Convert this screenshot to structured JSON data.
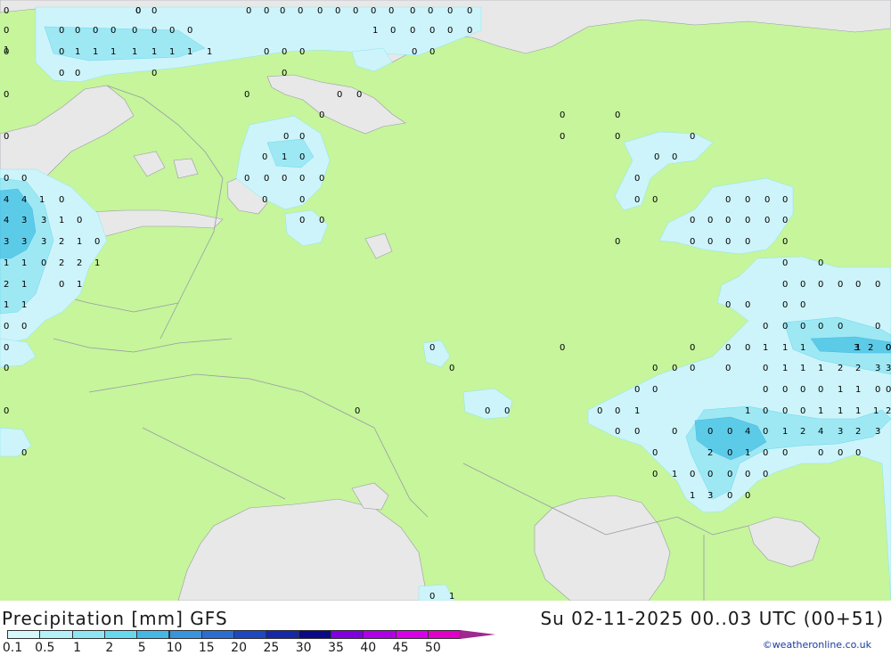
{
  "header": {
    "title": "Precipitation [mm] GFS",
    "datetime": "Su 02-11-2025 00..03 UTC (00+51)"
  },
  "credit": "©weatheronline.co.uk",
  "legend": {
    "ticks": [
      "0.1",
      "0.5",
      "1",
      "2",
      "5",
      "10",
      "15",
      "20",
      "25",
      "30",
      "35",
      "40",
      "45",
      "50"
    ],
    "colors": [
      "#d6f8fb",
      "#b4f0f8",
      "#8ee6f3",
      "#68d8ee",
      "#46b8e6",
      "#3a94dc",
      "#2a6ed2",
      "#1e48c0",
      "#1428a8",
      "#0a0a88",
      "#8000e0",
      "#b000e8",
      "#d800e8",
      "#e000c8",
      "#a02890"
    ]
  },
  "map_colors": {
    "land": "#c6f59c",
    "water": "#e8e8e8",
    "precip_light": "#cdf4fa",
    "precip_mid": "#9ee8f4",
    "precip_heavy": "#5ccbe8",
    "border": "#9a9aa4"
  },
  "map_labels": [
    "0",
    "0",
    "0",
    "0",
    "0",
    "0",
    "0",
    "0",
    "0",
    "0",
    "0",
    "0",
    "0",
    "0",
    "0",
    "0",
    "0",
    "0",
    "0",
    "0",
    "0",
    "0",
    "0",
    "1",
    "0",
    "0",
    "0",
    "0",
    "0",
    "0",
    "1",
    "0",
    "0",
    "1",
    "1",
    "1",
    "1",
    "1",
    "1",
    "1",
    "1",
    "0",
    "0",
    "0",
    "0",
    "0",
    "0",
    "0",
    "0",
    "0",
    "0",
    "0",
    "0",
    "0",
    "0",
    "0",
    "0",
    "0",
    "0",
    "0",
    "0",
    "0",
    "0",
    "0",
    "0",
    "0",
    "0",
    "0",
    "0",
    "0",
    "1",
    "0",
    "0",
    "0",
    "0",
    "0",
    "0",
    "0",
    "0",
    "0",
    "0",
    "0",
    "4",
    "4",
    "1",
    "0",
    "0",
    "0",
    "0",
    "0",
    "0",
    "0",
    "0",
    "4",
    "3",
    "3",
    "1",
    "0",
    "0",
    "0",
    "0",
    "0",
    "0",
    "0",
    "0",
    "0",
    "0",
    "0",
    "3",
    "3",
    "3",
    "2",
    "1",
    "0",
    "0",
    "0",
    "0",
    "0",
    "0",
    "0",
    "1",
    "1",
    "0",
    "2",
    "2",
    "1",
    "0",
    "0",
    "2",
    "1",
    "0",
    "1",
    "0",
    "0",
    "0",
    "0",
    "0",
    "0",
    "1",
    "1",
    "0",
    "0",
    "0",
    "0",
    "0",
    "0",
    "0",
    "0",
    "0",
    "1",
    "1",
    "1",
    "0",
    "0",
    "0",
    "0",
    "0",
    "0",
    "0",
    "0",
    "1",
    "1",
    "1",
    "2",
    "2",
    "3",
    "0",
    "0",
    "0",
    "0",
    "0",
    "0",
    "1",
    "1",
    "0",
    "0",
    "0",
    "0",
    "0",
    "0",
    "0",
    "0",
    "0",
    "1",
    "1",
    "0",
    "0",
    "0",
    "0",
    "0",
    "0",
    "0",
    "0",
    "1",
    "1",
    "1",
    "1",
    "2",
    "3",
    "2",
    "0",
    "0",
    "0",
    "0",
    "4",
    "0",
    "1",
    "2",
    "4",
    "3",
    "2",
    "3",
    "2",
    "0",
    "0",
    "0",
    "0",
    "1",
    "3",
    "0",
    "0",
    "0",
    "1",
    "0",
    "0",
    "0",
    "0",
    "0",
    "1",
    "3",
    "0",
    "0",
    "0",
    "1",
    "1",
    "0",
    "0"
  ]
}
